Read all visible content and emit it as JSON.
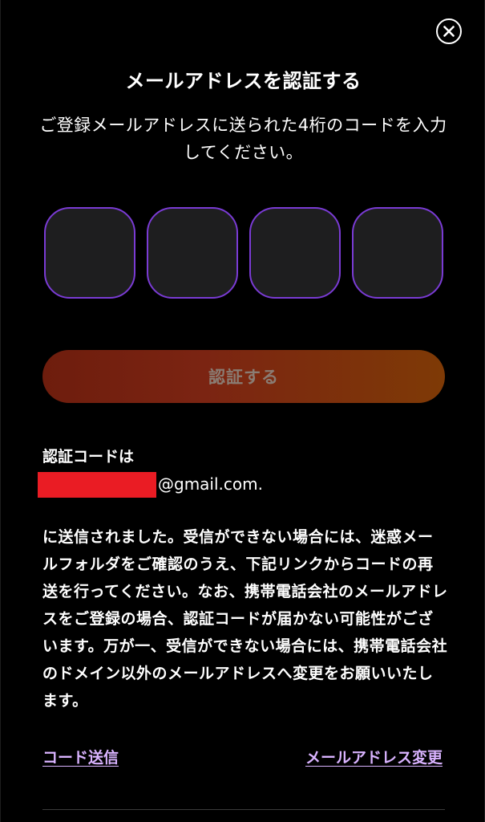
{
  "dialog": {
    "close_icon": "close-icon",
    "title": "メールアドレスを認証する",
    "subtitle": "ご登録メールアドレスに送られた4桁のコードを入力してください。"
  },
  "code_inputs": [
    {
      "value": ""
    },
    {
      "value": ""
    },
    {
      "value": ""
    },
    {
      "value": ""
    }
  ],
  "verify_button": {
    "label": "認証する"
  },
  "info": {
    "label": "認証コードは",
    "email_domain": "@gmail.com.",
    "message": "に送信されました。受信ができない場合には、迷惑メールフォルダをご確認のうえ、下記リンクからコードの再送を行ってください。なお、携帯電話会社のメールアドレスをご登録の場合、認証コードが届かない可能性がございます。万が一、受信ができない場合には、携帯電話会社のドメイン以外のメールアドレスへ変更をお願いいたします。"
  },
  "links": {
    "resend": "コード送信",
    "change_email": "メールアドレス変更"
  },
  "colors": {
    "background": "#000000",
    "input_border": "#7a3bd4",
    "input_fill": "#1e1e1f",
    "button_gradient_start": "#6e1d0d",
    "button_gradient_end": "#7e3a06",
    "link": "#d9b3ff",
    "redaction": "#ea1c24"
  }
}
